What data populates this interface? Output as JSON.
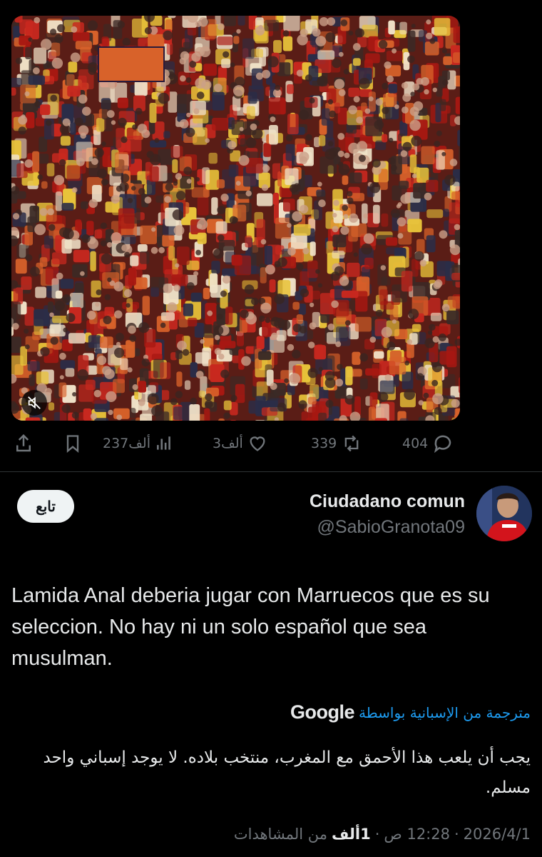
{
  "post": {
    "media": {
      "crowd_colors": [
        "#c8281f",
        "#e8c33a",
        "#a81812",
        "#3a2a26",
        "#f0e2c8",
        "#2a2d48",
        "#d8622a"
      ]
    },
    "actions": {
      "replies": "404",
      "reposts": "339",
      "likes": "3ألف",
      "views": "237ألف"
    }
  },
  "reply": {
    "author_name": "Ciudadano comun",
    "author_handle": "@SabioGranota09",
    "follow_label": "تابع",
    "text": "Lamida Anal deberia jugar con Marruecos que es su seleccion. No hay ni un solo español que sea musulman.",
    "translated_label": "مترجمة من الإسبانية بواسطة",
    "translator": "Google",
    "translation": "يجب أن يلعب هذا الأحمق مع المغرب، منتخب بلاده. لا يوجد إسباني واحد مسلم.",
    "meta": {
      "time": "12:28 ص",
      "date": "2026/4/1",
      "views_count": "1ألف",
      "views_label": "من المشاهدات",
      "sep": "·"
    }
  }
}
